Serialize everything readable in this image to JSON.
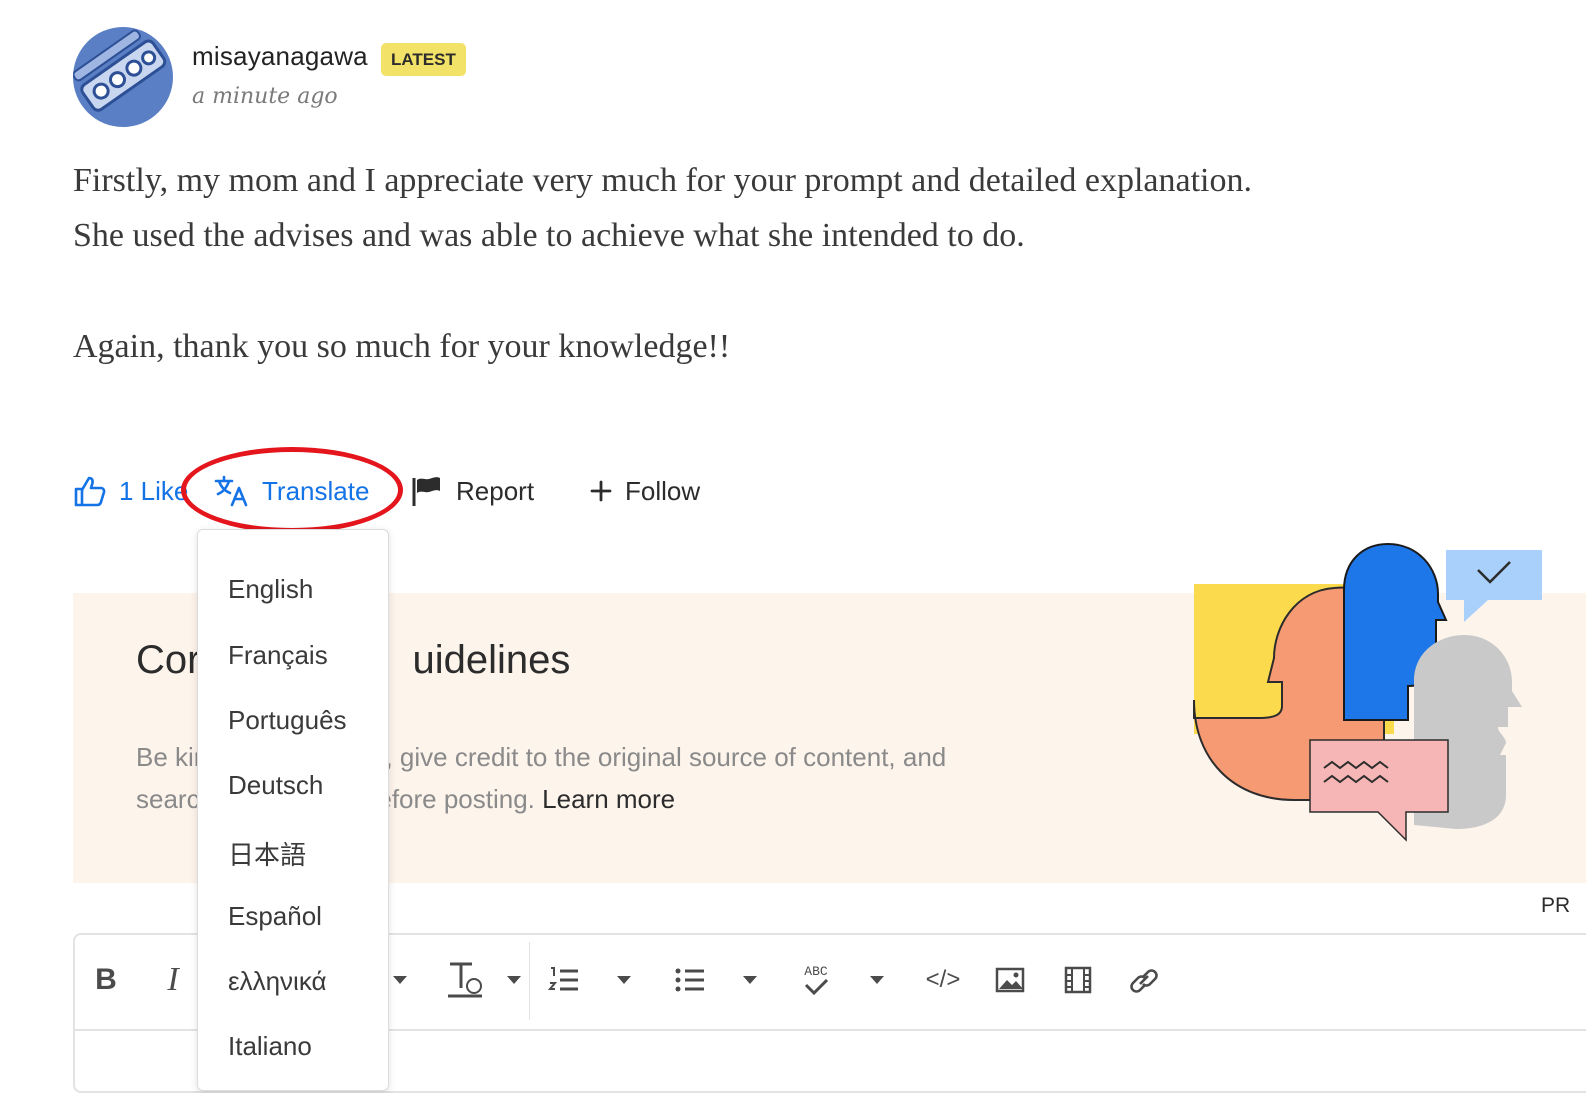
{
  "post": {
    "username": "misayanagawa",
    "badge": "LATEST",
    "timestamp": "a minute ago",
    "lines": [
      "Firstly, my mom and I appreciate very much for your prompt and detailed explanation.",
      "She used the advises and was able to achieve what she intended to do.",
      "Again, thank you so much for your knowledge!!"
    ]
  },
  "actions": {
    "like_label": "1 Like",
    "translate_label": "Translate",
    "report_label": "Report",
    "follow_label": "Follow"
  },
  "guidelines": {
    "title_prefix": "Cor",
    "title_suffix": "uidelines",
    "line1_prefix": "Be kir",
    "line1_suffix": ", give credit to the original source of content, and",
    "line2_prefix": "searcl",
    "line2_suffix": "efore posting.",
    "learn_more": "Learn more"
  },
  "editor": {
    "bold_label": "B",
    "italic_label": "I",
    "abc_label": "ABC",
    "code_label": "</>",
    "pr_label": "PR"
  },
  "language_menu": {
    "items": [
      "English",
      "Français",
      "Português",
      "Deutsch",
      "日本語",
      "Español",
      "ελληνικά",
      "Italiano"
    ]
  },
  "colors": {
    "link_blue": "#1473e6",
    "highlight_red": "#e4151c",
    "badge_yellow": "#f2e268",
    "banner_bg": "#fdf4ec"
  }
}
